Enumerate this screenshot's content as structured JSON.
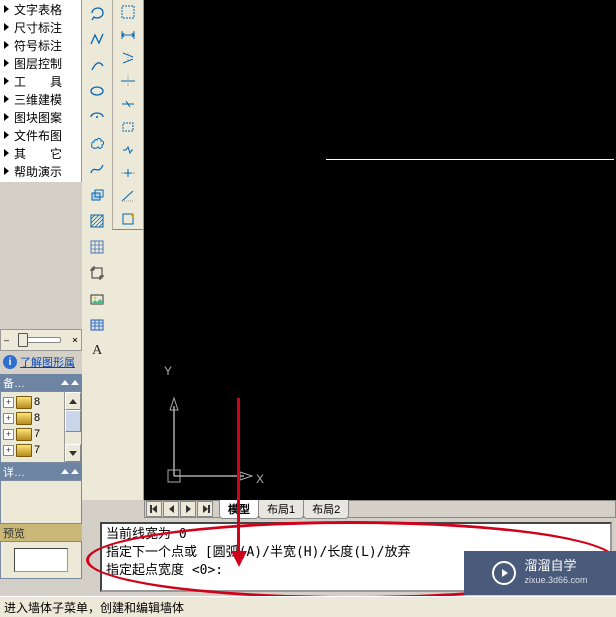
{
  "left_menu": {
    "items": [
      {
        "label": "文字表格"
      },
      {
        "label": "尺寸标注"
      },
      {
        "label": "符号标注"
      },
      {
        "label": "图层控制"
      },
      {
        "label": "工　　具"
      },
      {
        "label": "三维建模"
      },
      {
        "label": "图块图案"
      },
      {
        "label": "文件布图"
      },
      {
        "label": "其　　它"
      },
      {
        "label": "帮助演示"
      }
    ]
  },
  "info_link": "了解图形属",
  "palettes": {
    "backup": {
      "title": "备…"
    },
    "detail": {
      "title": "详…"
    },
    "preview": {
      "title": "预览"
    }
  },
  "tree": {
    "items": [
      {
        "label": "8"
      },
      {
        "label": "8"
      },
      {
        "label": "7"
      },
      {
        "label": "7"
      }
    ]
  },
  "toolbar_a": {
    "icons": [
      "lasso",
      "polyline",
      "arc",
      "ellipse",
      "ellipse-arc",
      "revision-cloud",
      "spline",
      "region",
      "hatch",
      "grid-tool",
      "crop",
      "photo",
      "table",
      "text-a"
    ]
  },
  "toolbar_b": {
    "icons": [
      "marquee",
      "dim-qdim",
      "dim-axis",
      "dim-h",
      "dim-slash",
      "rect-dashed",
      "chevrons",
      "plus-divider",
      "slope",
      "rect"
    ]
  },
  "canvas": {
    "x_label": "X",
    "y_label": "Y"
  },
  "tabs": {
    "items": [
      "模型",
      "布局1",
      "布局2"
    ],
    "active": 0
  },
  "cmd": {
    "line1": "当前线宽为  0",
    "line2": "指定下一个点或 [圆弧(A)/半宽(H)/长度(L)/放弃",
    "line3": "指定起点宽度 <0>:"
  },
  "statusbar": {
    "text": "进入墙体子菜单，创建和编辑墙体"
  },
  "watermark": {
    "title": "溜溜自学",
    "sub": "zixue.3d66.com"
  }
}
